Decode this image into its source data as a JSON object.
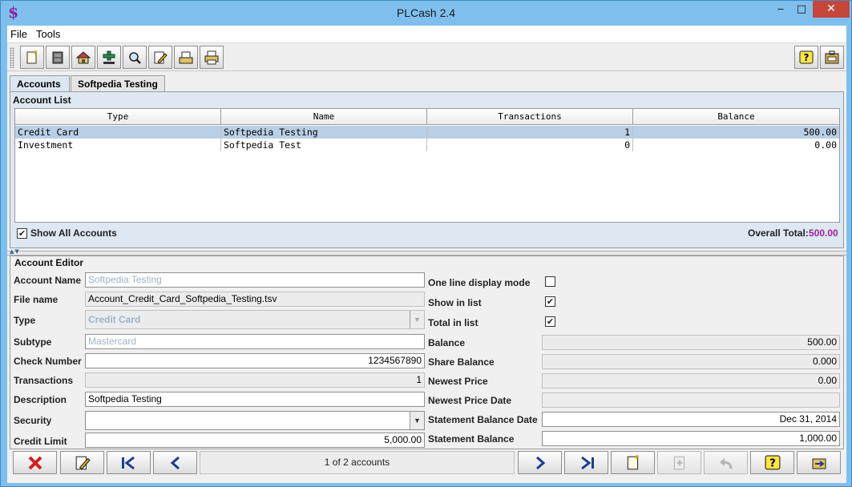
{
  "window": {
    "title": "PLCash 2.4",
    "minimize": "‒",
    "maximize": "□",
    "close": "✕"
  },
  "app_icon": "$",
  "menu": [
    "File",
    "Tools"
  ],
  "tabs": [
    {
      "label": "Accounts",
      "active": true
    },
    {
      "label": "Softpedia Testing",
      "active": false
    }
  ],
  "account_list": {
    "legend": "Account List",
    "columns": [
      "Type",
      "Name",
      "Transactions",
      "Balance"
    ],
    "rows": [
      {
        "type": "Credit Card",
        "name": "Softpedia Testing",
        "transactions": "1",
        "balance": "500.00",
        "selected": true
      },
      {
        "type": "Investment",
        "name": "Softpedia Test",
        "transactions": "0",
        "balance": "0.00",
        "selected": false
      }
    ],
    "show_all_label": "Show All Accounts",
    "show_all_checked": true,
    "overall_total_label": "Overall Total:",
    "overall_total_value": "500.00",
    "total_color": "#a020a0"
  },
  "account_editor": {
    "legend": "Account Editor",
    "left": {
      "account_name_label": "Account Name",
      "account_name": "Softpedia Testing",
      "file_name_label": "File name",
      "file_name": "Account_Credit_Card_Softpedia_Testing.tsv",
      "type_label": "Type",
      "type": "Credit Card",
      "subtype_label": "Subtype",
      "subtype": "Mastercard",
      "check_number_label": "Check Number",
      "check_number": "1234567890",
      "transactions_label": "Transactions",
      "transactions": "1",
      "description_label": "Description",
      "description": "Softpedia Testing",
      "security_label": "Security",
      "security": "",
      "credit_limit_label": "Credit Limit",
      "credit_limit": "5,000.00"
    },
    "right": {
      "one_line_label": "One line display mode",
      "one_line_checked": false,
      "show_in_list_label": "Show in list",
      "show_in_list_checked": true,
      "total_in_list_label": "Total in list",
      "total_in_list_checked": true,
      "balance_label": "Balance",
      "balance": "500.00",
      "share_balance_label": "Share Balance",
      "share_balance": "0.000",
      "newest_price_label": "Newest Price",
      "newest_price": "0.00",
      "newest_price_date_label": "Newest Price Date",
      "newest_price_date": "",
      "statement_balance_date_label": "Statement Balance Date",
      "statement_balance_date": "Dec 31, 2014",
      "statement_balance_label": "Statement Balance",
      "statement_balance": "1,000.00"
    }
  },
  "navigation": {
    "status": "1 of 2 accounts"
  },
  "checkmark": "✔",
  "dropdown_arrow": "▼"
}
